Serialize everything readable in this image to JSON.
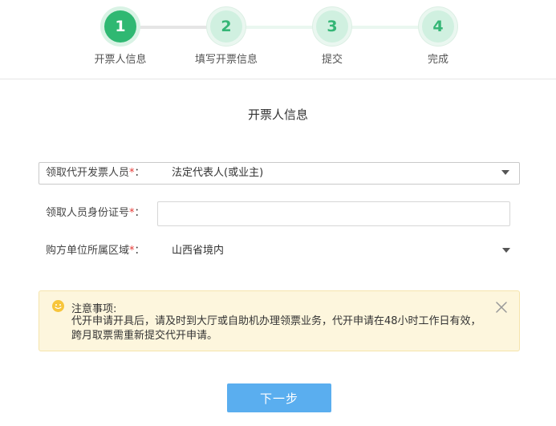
{
  "stepper": {
    "steps": [
      {
        "number": "1",
        "label": "开票人信息",
        "state": "active"
      },
      {
        "number": "2",
        "label": "填写开票信息",
        "state": "pending"
      },
      {
        "number": "3",
        "label": "提交",
        "state": "pending"
      },
      {
        "number": "4",
        "label": "完成",
        "state": "pending"
      }
    ]
  },
  "form": {
    "title": "开票人信息",
    "fields": {
      "collector": {
        "label": "领取代开发票人员",
        "required_mark": "*",
        "suffix": "：",
        "value": "法定代表人(或业主)",
        "icon": "caret-down-icon"
      },
      "id_number": {
        "label": "领取人员身份证号",
        "required_mark": "*",
        "suffix": "：",
        "value": "",
        "placeholder": ""
      },
      "buyer_region": {
        "label": "购方单位所属区域",
        "required_mark": "*",
        "suffix": "：",
        "value": "山西省境内",
        "icon": "caret-down-icon"
      }
    }
  },
  "notice": {
    "icon": "smile-icon",
    "title": "注意事项:",
    "body": "代开申请开具后，请及时到大厅或自助机办理领票业务，代开申请在48小时工作日有效，跨月取票需重新提交代开申请。",
    "close_icon": "close-icon"
  },
  "actions": {
    "next_label": "下一步"
  },
  "colors": {
    "step_active": "#2fb872",
    "step_pending": "#d0f0e0",
    "required": "#e53935",
    "notice_bg": "#fdf6dd",
    "primary_button": "#5aaeef"
  }
}
